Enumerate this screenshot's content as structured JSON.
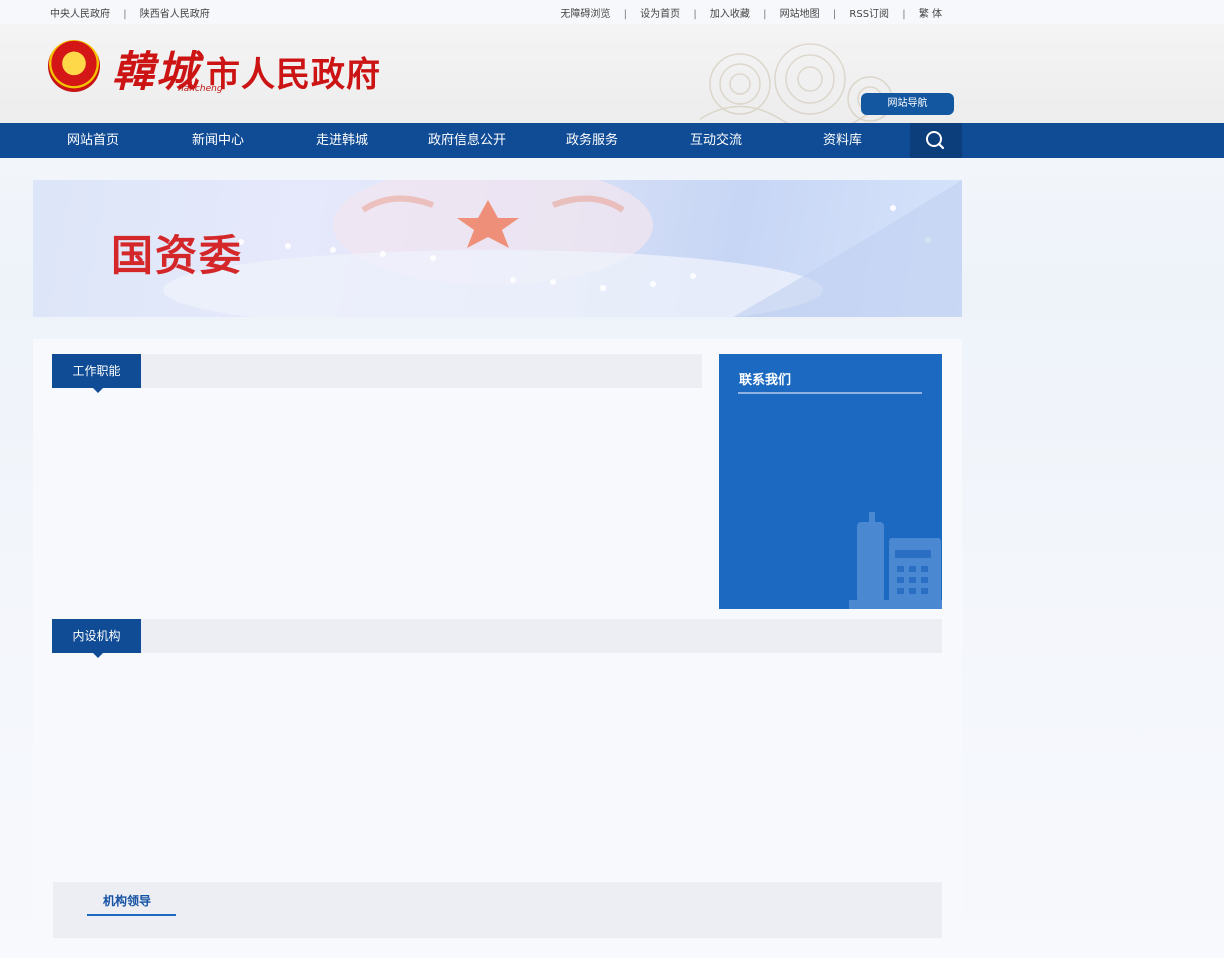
{
  "topbar": {
    "left_links": [
      "中央人民政府",
      "陕西省人民政府"
    ],
    "right_links": [
      "无障碍浏览",
      "设为首页",
      "加入收藏",
      "网站地图",
      "RSS订阅",
      "繁 体"
    ]
  },
  "header": {
    "logo_big": "韓城",
    "logo_small": "市人民政府",
    "pinyin": "hancheng",
    "site_search_button": "网站导航"
  },
  "nav": {
    "items": [
      "网站首页",
      "新闻中心",
      "走进韩城",
      "政府信息公开",
      "政务服务",
      "互动交流",
      "资料库"
    ],
    "search_icon": "search-icon"
  },
  "banner": {
    "title": "国资委"
  },
  "sections": {
    "work_duties": "工作职能",
    "contact_us": "联系我们",
    "internal_agencies": "内设机构",
    "agency_leaders": "机构领导"
  },
  "colors": {
    "nav_blue": "#0f4c95",
    "contact_blue": "#1b69c0",
    "logo_red": "#cc1414"
  }
}
